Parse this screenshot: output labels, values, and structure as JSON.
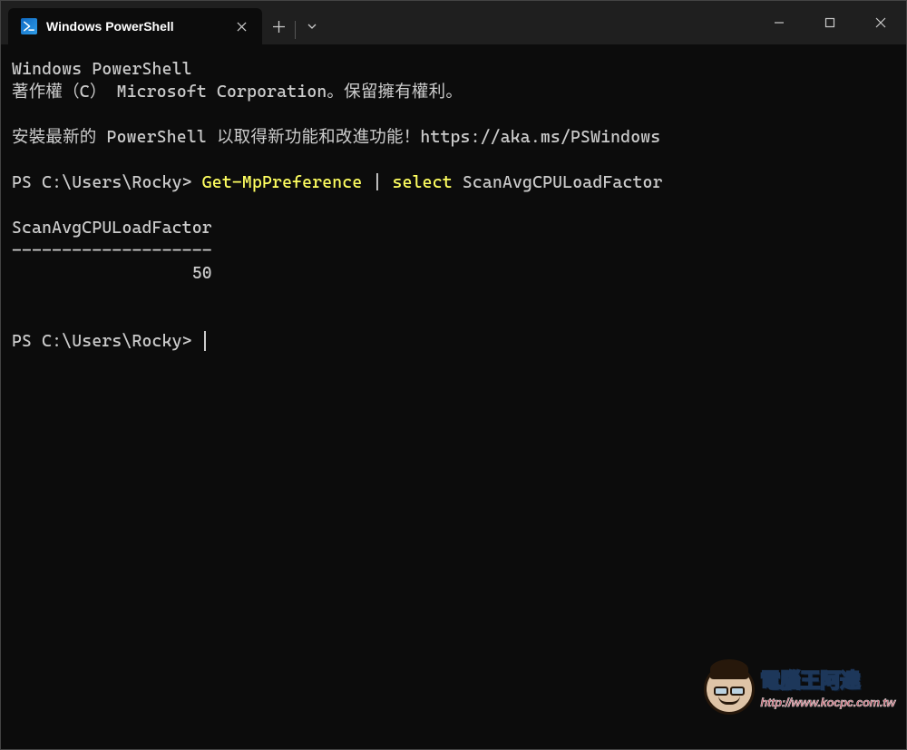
{
  "titlebar": {
    "tab": {
      "title": "Windows PowerShell",
      "icon": "powershell-icon"
    }
  },
  "terminal": {
    "header_line1": "Windows PowerShell",
    "header_line2": "著作權（C） Microsoft Corporation。保留擁有權利。",
    "install_msg_prefix": "安裝最新的 PowerShell 以取得新功能和改進功能！",
    "install_msg_url": "https://aka.ms/PSWindows",
    "prompt_path": "PS C:\\Users\\Rocky> ",
    "command": {
      "cmdlet": "Get-MpPreference",
      "pipe": " | ",
      "keyword": "select",
      "arg": " ScanAvgCPULoadFactor"
    },
    "output": {
      "column_header": "ScanAvgCPULoadFactor",
      "separator": "--------------------",
      "value": "                  50"
    }
  },
  "watermark": {
    "title": "電腦王阿達",
    "url": "http://www.kocpc.com.tw"
  }
}
